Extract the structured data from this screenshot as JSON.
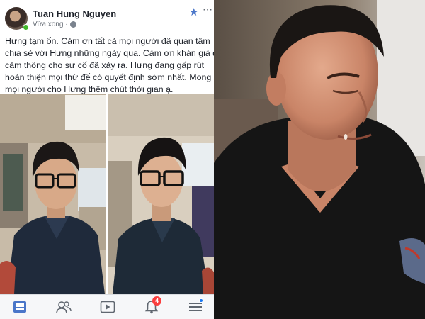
{
  "post": {
    "author": "Tuan Hung Nguyen",
    "time": "Vừa xong",
    "text_lines": [
      "Hưng tạm ổn. Cảm ơn tất cả mọi người đã quan tâm",
      "chia sẻ với Hưng những ngày qua. Cảm ơn khán giả đã",
      "cảm thông cho sự cố đã xảy ra. Hưng đang gấp rút",
      "hoàn thiện mọi thứ để có quyết định sớm nhất. Mong",
      "mọi người cho Hưng thêm chút thời gian ạ."
    ]
  },
  "tabbar": {
    "notifications_count": "4"
  },
  "colors": {
    "accent": "#4a76c9",
    "badge": "#fa3e3e",
    "online": "#42b72a",
    "text": "#1d2129",
    "muted": "#606770"
  },
  "icons": [
    "globe-icon",
    "star-icon",
    "news-feed-icon",
    "friends-icon",
    "watch-icon",
    "bell-icon",
    "menu-icon"
  ]
}
